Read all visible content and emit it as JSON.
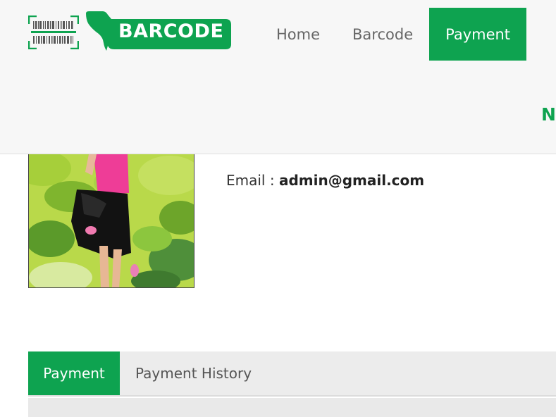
{
  "brand": {
    "logo_text": "BARCODE",
    "accent_color": "#0ea350"
  },
  "nav": {
    "items": [
      {
        "label": "Home",
        "active": false
      },
      {
        "label": "Barcode",
        "active": false
      },
      {
        "label": "Payment",
        "active": true
      }
    ]
  },
  "header": {
    "cut_text": "N"
  },
  "profile": {
    "email_label": "Email :",
    "email_value": "admin@gmail.com"
  },
  "tabs": [
    {
      "label": "Payment",
      "active": true
    },
    {
      "label": "Payment History",
      "active": false
    }
  ]
}
